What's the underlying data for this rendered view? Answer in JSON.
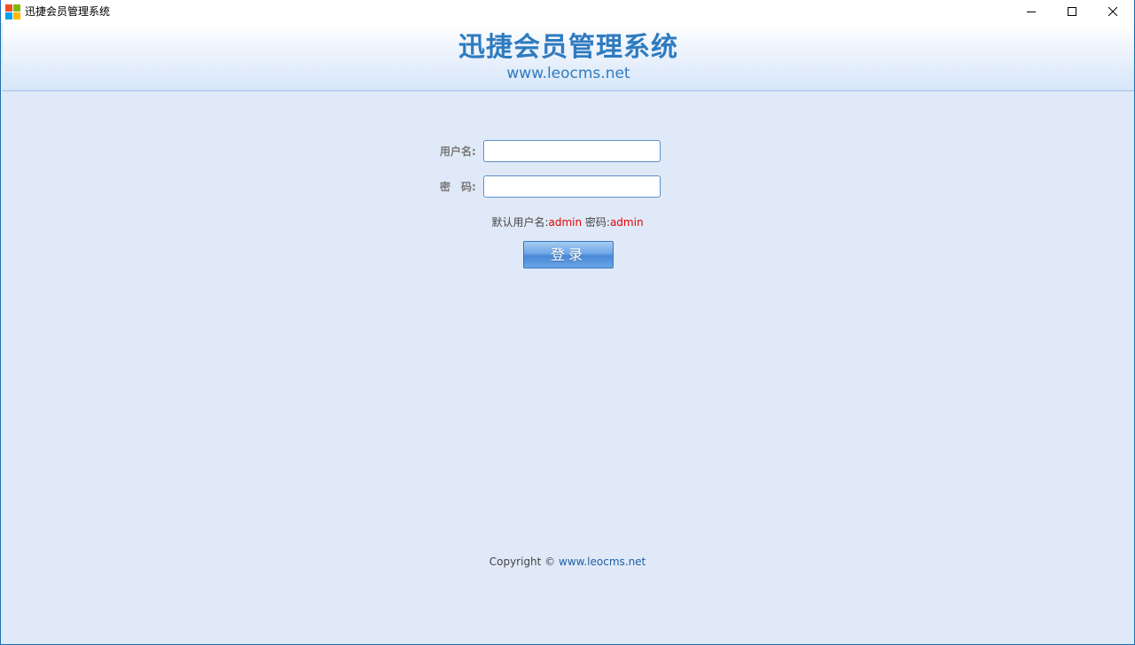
{
  "window": {
    "title": "迅捷会员管理系统",
    "app_icon": "windows-logo-icon",
    "controls": {
      "minimize_icon": "minimize-icon",
      "maximize_icon": "maximize-icon",
      "close_icon": "close-icon"
    }
  },
  "header": {
    "title": "迅捷会员管理系统",
    "url": "www.leocms.net"
  },
  "login_form": {
    "username_label": "用户名:",
    "username_value": "",
    "password_label": "密　码:",
    "password_value": "",
    "hint_prefix": "默认用户名:",
    "hint_username": "admin",
    "hint_password_label": " 密码:",
    "hint_password": "admin",
    "submit_label": "登录"
  },
  "footer": {
    "copyright_text": "Copyright © ",
    "copyright_link": "www.leocms.net"
  },
  "colors": {
    "accent": "#2f7bbf",
    "hint_red": "#e60000",
    "background": "#e0e9f7"
  }
}
